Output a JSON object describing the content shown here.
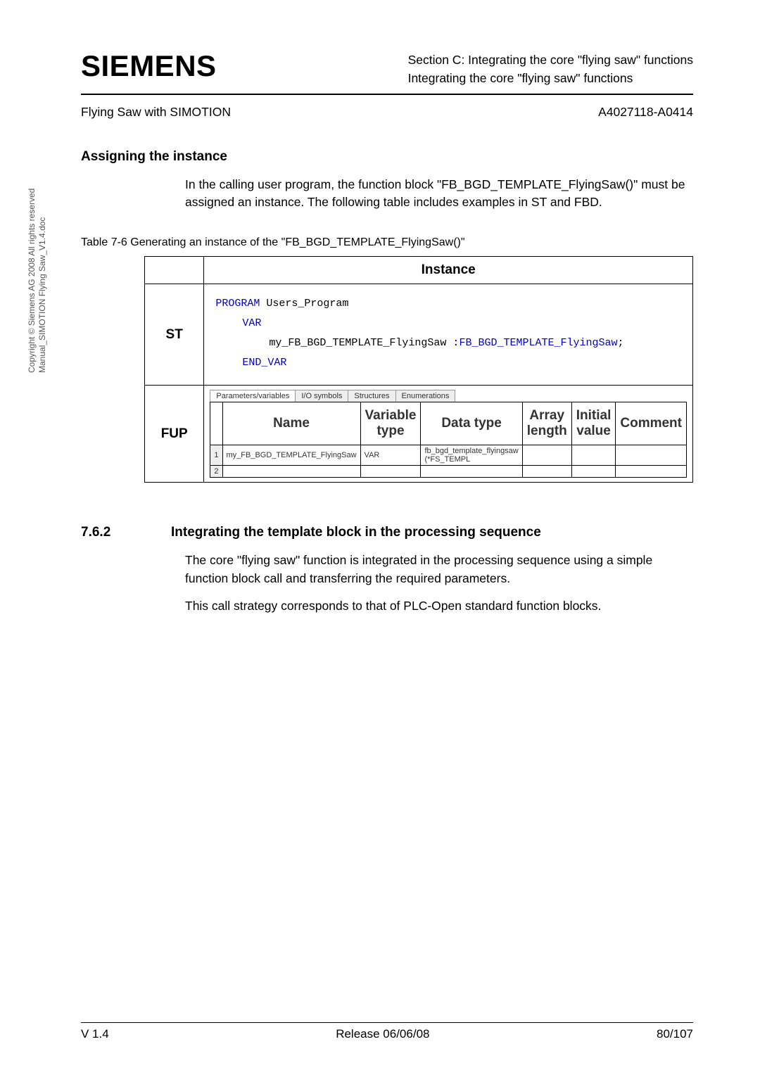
{
  "side_copyright_l1": "Copyright © Siemens AG 2008 All rights reserved",
  "side_copyright_l2": "Manual_SIMOTION Flying Saw_V1.4.doc",
  "brand": "SIEMENS",
  "header_right_l1": "Section C:  Integrating the core \"flying saw\" functions",
  "header_right_l2": "Integrating the core \"flying saw\" functions",
  "subheader_left": "Flying Saw with SIMOTION",
  "subheader_right": "A4027118-A0414",
  "h_assign": "Assigning the instance",
  "p_assign": "In the calling user program, the function block \"FB_BGD_TEMPLATE_FlyingSaw()\" must be assigned an instance. The following table includes examples in ST and FBD.",
  "tbl_caption": "Table 7-6  Generating an instance of the \"FB_BGD_TEMPLATE_FlyingSaw()\"",
  "tbl_head_instance": "Instance",
  "tbl_row_st": "ST",
  "tbl_row_fup": "FUP",
  "st_l1_kw": "PROGRAM",
  "st_l1_id": " Users_Program",
  "st_l2_kw": "VAR",
  "st_l3_id": "my_FB_BGD_TEMPLATE_FlyingSaw   :",
  "st_l3_kw2": "FB_BGD_TEMPLATE_FlyingSaw",
  "st_l4_kw": "END_VAR",
  "fup_tabs": {
    "t1": "Parameters/variables",
    "t2": "I/O symbols",
    "t3": "Structures",
    "t4": "Enumerations"
  },
  "fup_cols": {
    "c1": "Name",
    "c2": "Variable type",
    "c3": "Data type",
    "c4": "Array length",
    "c5": "Initial value",
    "c6": "Comment"
  },
  "fup_row1": {
    "n": "1",
    "name": "my_FB_BGD_TEMPLATE_FlyingSaw",
    "vtype": "VAR",
    "dtype": "fb_bgd_template_flyingsaw (*FS_TEMPL",
    "alen": "",
    "ival": "",
    "cmt": ""
  },
  "fup_row2_n": "2",
  "sec_num": "7.6.2",
  "sec_title": "Integrating the template block in the processing sequence",
  "p_seq1": "The core \"flying saw\" function is integrated in the processing sequence using a simple function block call and transferring the required parameters.",
  "p_seq2": "This call strategy corresponds to that of PLC-Open standard function blocks.",
  "footer": {
    "left": "V 1.4",
    "center": "Release 06/06/08",
    "right": "80/107"
  }
}
